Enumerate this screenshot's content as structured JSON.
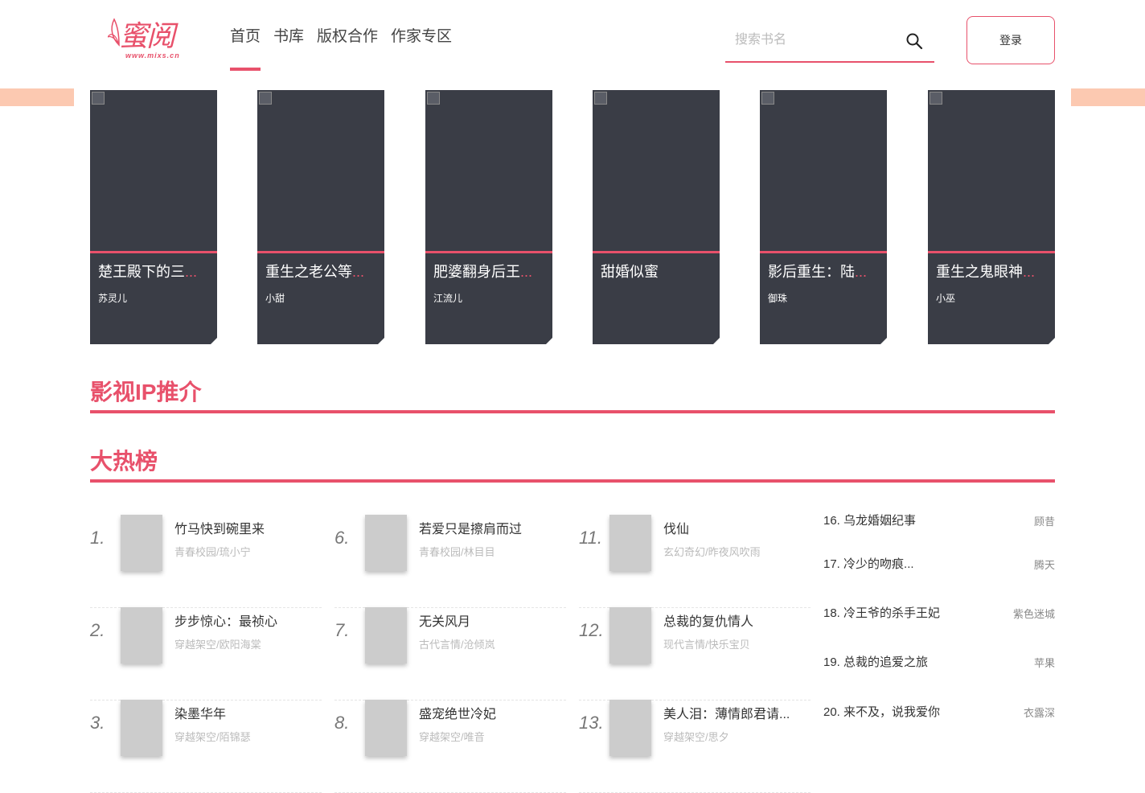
{
  "colors": {
    "accent": "#e8516b",
    "card_bg": "#3a3d46",
    "side_bar": "#fcc9b1"
  },
  "logo": {
    "mark": "蜜阅",
    "url": "www.mixs.cn"
  },
  "nav": [
    "首页",
    "书库",
    "版权合作",
    "作家专区"
  ],
  "search": {
    "placeholder": "搜索书名",
    "icon": "search-icon"
  },
  "login_label": "登录",
  "cards": [
    {
      "title": "楚王殿下的三",
      "author": "苏灵儿",
      "truncated": true
    },
    {
      "title": "重生之老公等",
      "author": "小甜",
      "truncated": true
    },
    {
      "title": "肥婆翻身后王",
      "author": "江流儿",
      "truncated": true
    },
    {
      "title": "甜婚似蜜",
      "author": "",
      "truncated": false
    },
    {
      "title": "影后重生：陆",
      "author": "御珠",
      "truncated": true
    },
    {
      "title": "重生之鬼眼神",
      "author": "小巫",
      "truncated": true
    }
  ],
  "sections": {
    "ip": "影视IP推介",
    "hot": "大热榜"
  },
  "hot_columns": [
    [
      {
        "num": "1.",
        "name": "竹马快到碗里来",
        "meta": "青春校园/琉小宁"
      },
      {
        "num": "2.",
        "name": "步步惊心：最祯心",
        "meta": "穿越架空/欧阳海棠"
      },
      {
        "num": "3.",
        "name": "染墨华年",
        "meta": "穿越架空/陌锦瑟"
      }
    ],
    [
      {
        "num": "6.",
        "name": "若爱只是擦肩而过",
        "meta": "青春校园/林目目"
      },
      {
        "num": "7.",
        "name": "无关风月",
        "meta": "古代言情/沧倾岚"
      },
      {
        "num": "8.",
        "name": "盛宠绝世冷妃",
        "meta": "穿越架空/唯音"
      }
    ],
    [
      {
        "num": "11.",
        "name": "伐仙",
        "meta": "玄幻奇幻/昨夜风吹雨"
      },
      {
        "num": "12.",
        "name": "总裁的复仇情人",
        "meta": "现代言情/快乐宝贝"
      },
      {
        "num": "13.",
        "name": "美人泪：薄情郎君请...",
        "meta": "穿越架空/思夕"
      }
    ]
  ],
  "rank_list": [
    {
      "title": "16. 乌龙婚姻纪事",
      "author": "顾昔"
    },
    {
      "title": "17. 冷少的吻痕...",
      "author": "腾天"
    },
    {
      "title": "18. 冷王爷的杀手王妃",
      "author": "紫色迷城"
    },
    {
      "title": "19. 总裁的追爱之旅",
      "author": "苹果"
    },
    {
      "title": "20. 来不及，说我爱你",
      "author": "衣露深"
    }
  ]
}
